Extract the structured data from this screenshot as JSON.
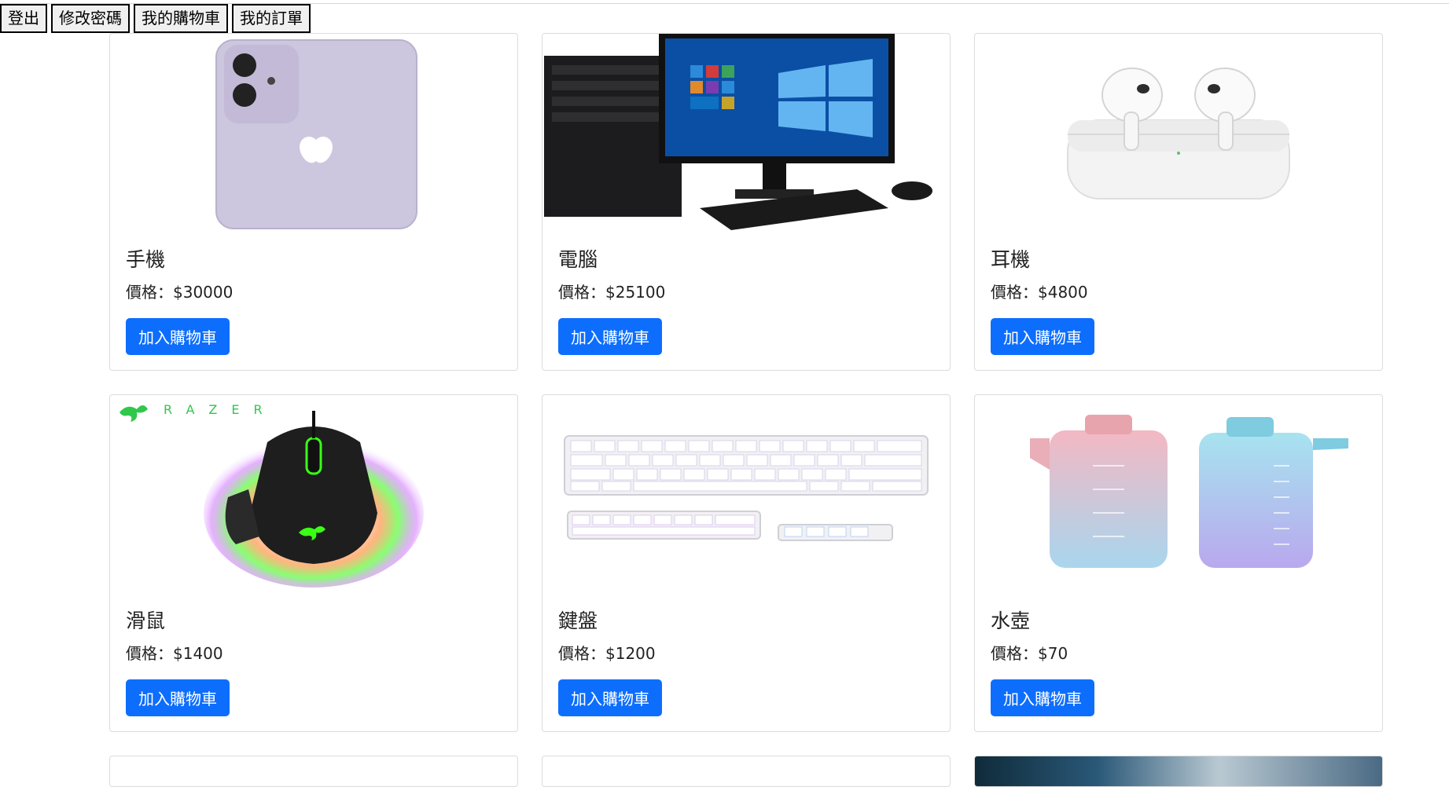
{
  "topbar": {
    "logout": "登出",
    "change_password": "修改密碼",
    "my_cart": "我的購物車",
    "my_orders": "我的訂單"
  },
  "products": [
    {
      "name": "手機",
      "price_label": "價格：$30000",
      "button": "加入購物車",
      "image_icon": "smartphone-image"
    },
    {
      "name": "電腦",
      "price_label": "價格：$25100",
      "button": "加入購物車",
      "image_icon": "desktop-computer-image"
    },
    {
      "name": "耳機",
      "price_label": "價格：$4800",
      "button": "加入購物車",
      "image_icon": "earbuds-image"
    },
    {
      "name": "滑鼠",
      "price_label": "價格：$1400",
      "button": "加入購物車",
      "image_icon": "gaming-mouse-image",
      "brand_text": "RAZER"
    },
    {
      "name": "鍵盤",
      "price_label": "價格：$1200",
      "button": "加入購物車",
      "image_icon": "keyboard-image"
    },
    {
      "name": "水壺",
      "price_label": "價格：$70",
      "button": "加入購物車",
      "image_icon": "water-bottle-image"
    }
  ],
  "colors": {
    "primary_button": "#0d6efd",
    "card_border": "#dcdcdc"
  }
}
